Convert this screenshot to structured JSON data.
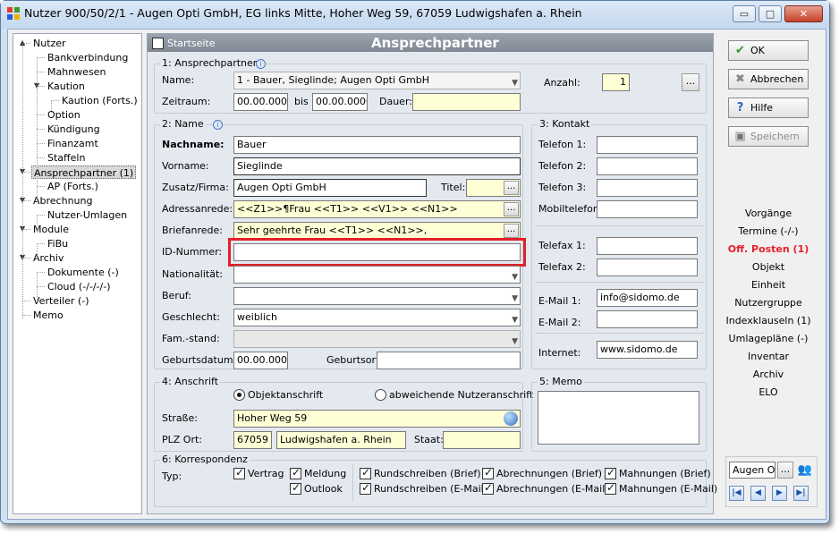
{
  "window": {
    "title": "Nutzer 900/50/2/1 - Augen Opti GmbH, EG links Mitte, Hoher Weg 59, 67059 Ludwigshafen a. Rhein",
    "min": "▭",
    "max": "□",
    "close": "✕"
  },
  "tree": [
    {
      "label": "Nutzer",
      "indent": 0,
      "exp": "▲"
    },
    {
      "label": "Bankverbindung",
      "indent": 1
    },
    {
      "label": "Mahnwesen",
      "indent": 1
    },
    {
      "label": "Kaution",
      "indent": 1,
      "exp": "▼"
    },
    {
      "label": "Kaution (Forts.)",
      "indent": 2
    },
    {
      "label": "Option",
      "indent": 1
    },
    {
      "label": "Kündigung",
      "indent": 1
    },
    {
      "label": "Finanzamt",
      "indent": 1
    },
    {
      "label": "Staffeln",
      "indent": 1
    },
    {
      "label": "Ansprechpartner (1)",
      "indent": 0,
      "exp": "▼",
      "selected": true
    },
    {
      "label": "AP (Forts.)",
      "indent": 1
    },
    {
      "label": "Abrechnung",
      "indent": 0,
      "exp": "▼"
    },
    {
      "label": "Nutzer-Umlagen",
      "indent": 1
    },
    {
      "label": "Module",
      "indent": 0,
      "exp": "▼"
    },
    {
      "label": "FiBu",
      "indent": 1
    },
    {
      "label": "Archiv",
      "indent": 0,
      "exp": "▼"
    },
    {
      "label": "Dokumente (-)",
      "indent": 1
    },
    {
      "label": "Cloud (-/-/-/-)",
      "indent": 1
    },
    {
      "label": "Verteiler (-)",
      "indent": 0
    },
    {
      "label": "Memo",
      "indent": 0
    }
  ],
  "main": {
    "startseite": "Startseite",
    "title": "Ansprechpartner",
    "g1": {
      "title": "1: Ansprechpartner",
      "name_label": "Name:",
      "name_value": "1 - Bauer, Sieglinde; Augen Opti GmbH",
      "zeitraum_label": "Zeitraum:",
      "from": "00.00.0000",
      "bis": "bis",
      "to": "00.00.0000",
      "dauer_label": "Dauer:",
      "dauer": "",
      "anzahl_label": "Anzahl:",
      "anzahl": "1",
      "dots": "..."
    },
    "g2": {
      "title": "2: Name",
      "nachname_label": "Nachname:",
      "nachname": "Bauer",
      "vorname_label": "Vorname:",
      "vorname": "Sieglinde",
      "zusatz_label": "Zusatz/Firma:",
      "zusatz": "Augen Opti GmbH",
      "titel_label": "Titel:",
      "titel": "",
      "adressanrede_label": "Adressanrede:",
      "adressanrede": "<<Z1>>¶Frau <<T1>> <<V1>> <<N1>>",
      "briefanrede_label": "Briefanrede:",
      "briefanrede": "Sehr geehrte Frau <<T1>> <<N1>>,",
      "id_label": "ID-Nummer:",
      "id": "",
      "nationalitaet_label": "Nationalität:",
      "nationalitaet": "",
      "beruf_label": "Beruf:",
      "beruf": "",
      "geschlecht_label": "Geschlecht:",
      "geschlecht": "weiblich",
      "famstand_label": "Fam.-stand:",
      "famstand": "",
      "geburtsdatum_label": "Geburtsdatum:",
      "geburtsdatum": "00.00.0000",
      "geburtsort_label": "Geburtsort:",
      "geburtsort": ""
    },
    "g3": {
      "title": "3: Kontakt",
      "telefon1": "Telefon 1:",
      "telefon2": "Telefon 2:",
      "telefon3": "Telefon 3:",
      "mobil": "Mobiltelefon:",
      "telefax1": "Telefax 1:",
      "telefax2": "Telefax 2:",
      "email1_label": "E-Mail 1:",
      "email1": "info@sidomo.de",
      "email2_label": "E-Mail 2:",
      "internet_label": "Internet:",
      "internet": "www.sidomo.de"
    },
    "g4": {
      "title": "4: Anschrift",
      "objekt": "Objektanschrift",
      "abweichend": "abweichende Nutzeranschrift",
      "strasse_label": "Straße:",
      "strasse": "Hoher Weg 59",
      "plz_label": "PLZ Ort:",
      "plz": "67059",
      "ort": "Ludwigshafen a. Rhein",
      "staat_label": "Staat:",
      "staat": ""
    },
    "g5": {
      "title": "5: Memo"
    },
    "g6": {
      "title": "6: Korrespondenz",
      "typ": "Typ:",
      "vertrag": "Vertrag",
      "meldung": "Meldung",
      "outlook": "Outlook",
      "rs_brief": "Rundschreiben (Brief)",
      "rs_email": "Rundschreiben (E-Mail)",
      "ab_brief": "Abrechnungen (Brief)",
      "ab_email": "Abrechnungen (E-Mail)",
      "ma_brief": "Mahnungen (Brief)",
      "ma_email": "Mahnungen (E-Mail)"
    }
  },
  "right": {
    "ok": "OK",
    "abbrechen": "Abbrechen",
    "hilfe": "Hilfe",
    "speichern": "Speichern",
    "links": [
      "Vorgänge",
      "Termine (-/-)",
      "Off. Posten (1)",
      "Objekt",
      "Einheit",
      "Nutzergruppe",
      "Indexklauseln (1)",
      "Umlagepläne (-)",
      "Inventar",
      "Archiv",
      "ELO"
    ],
    "nav_value": "Augen O",
    "dots": "..."
  },
  "colors": {
    "highlight": "#e3202a",
    "offposten": "#e3202a",
    "input_yellow": "#ffffd6"
  }
}
